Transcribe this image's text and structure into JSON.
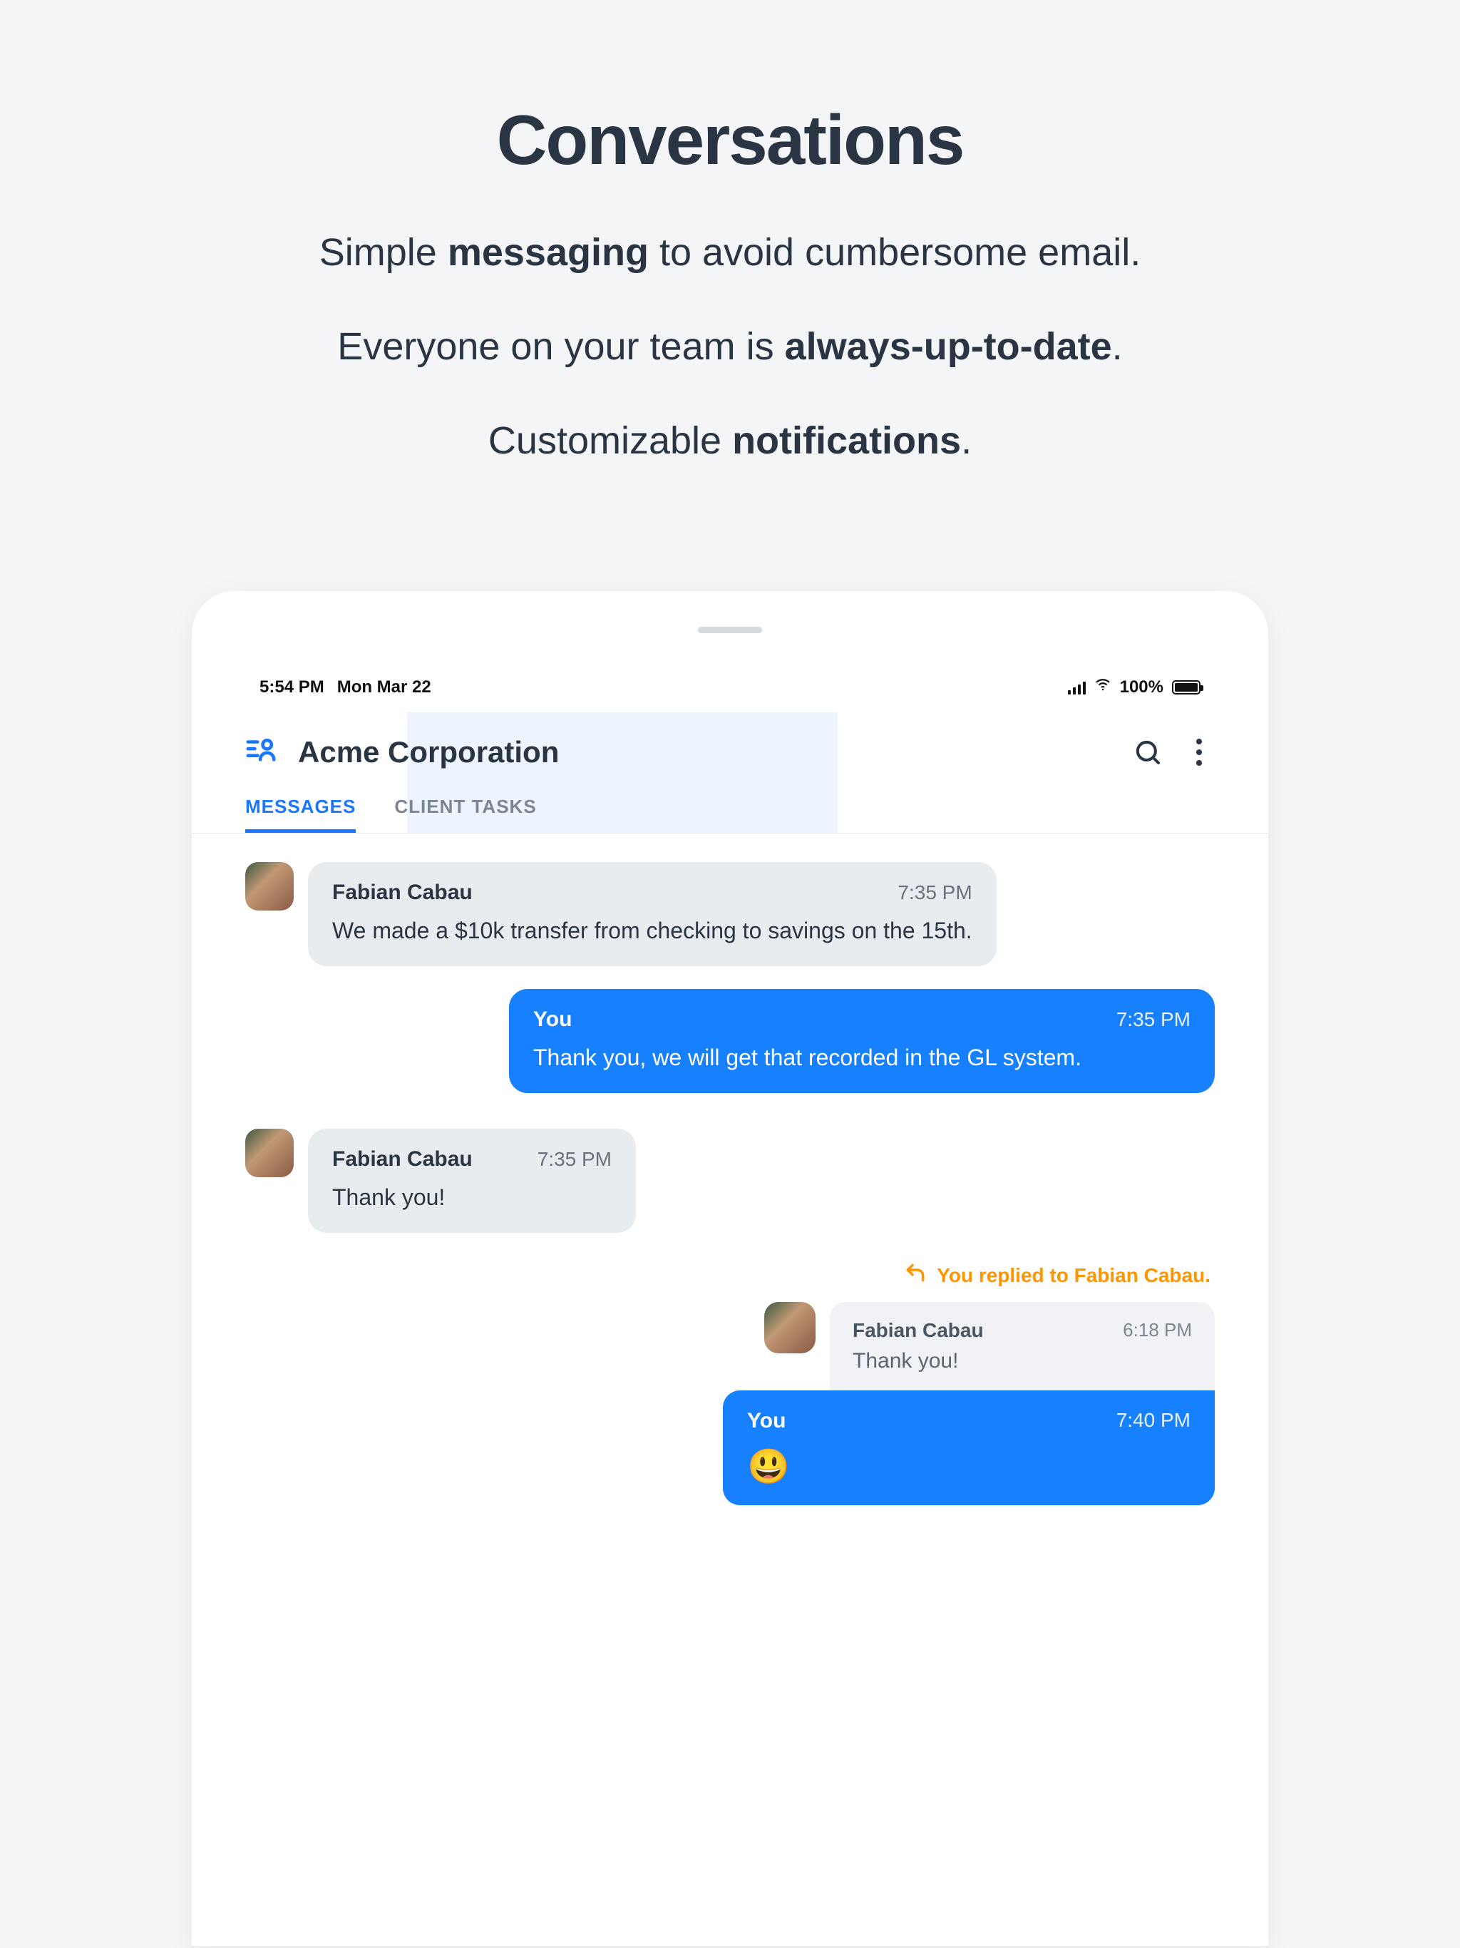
{
  "hero": {
    "title": "Conversations",
    "line1_a": "Simple ",
    "line1_b": "messaging",
    "line1_c": " to avoid cumbersome email.",
    "line2_a": "Everyone on your team is ",
    "line2_b": "always-up-to-date",
    "line2_c": ".",
    "line3_a": "Customizable ",
    "line3_b": "notifications",
    "line3_c": "."
  },
  "status": {
    "time": "5:54 PM",
    "date": "Mon Mar 22",
    "battery": "100%"
  },
  "header": {
    "org": "Acme Corporation"
  },
  "tabs": {
    "messages": "MESSAGES",
    "client_tasks": "CLIENT TASKS"
  },
  "messages": [
    {
      "side": "left",
      "sender": "Fabian Cabau",
      "time": "7:35 PM",
      "body": "We made a $10k transfer from checking to savings on the 15th."
    },
    {
      "side": "right",
      "sender": "You",
      "time": "7:35 PM",
      "body": "Thank you, we will get that recorded in the GL system."
    },
    {
      "side": "left",
      "sender": "Fabian Cabau",
      "time": "7:35 PM",
      "body": "Thank you!"
    }
  ],
  "reply": {
    "notice": "You replied to Fabian Cabau.",
    "quoted_sender": "Fabian Cabau",
    "quoted_time": "6:18 PM",
    "quoted_body": "Thank you!",
    "sender": "You",
    "time": "7:40 PM",
    "emoji": "😃"
  }
}
